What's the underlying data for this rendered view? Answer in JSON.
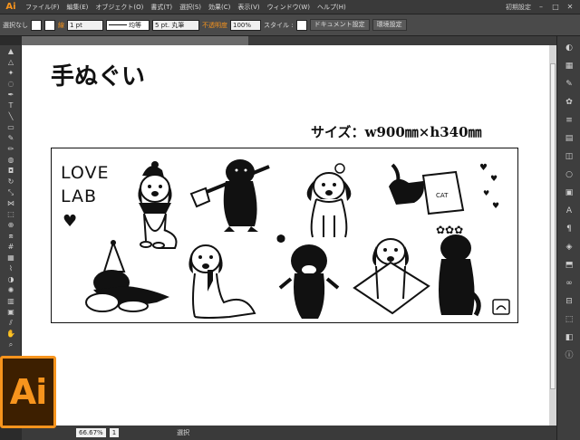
{
  "app": {
    "logo": "Ai",
    "menu": [
      "ファイル(F)",
      "編集(E)",
      "オブジェクト(O)",
      "書式(T)",
      "選択(S)",
      "効果(C)",
      "表示(V)",
      "ウィンドウ(W)",
      "ヘルプ(H)"
    ],
    "workspace": "初期設定",
    "window_controls": [
      "–",
      "□",
      "✕"
    ]
  },
  "control_bar": {
    "selection": "選択なし",
    "stroke_label": "線",
    "stroke_weight": "1 pt",
    "stroke_style": "均等",
    "brush": "5 pt. 丸筆",
    "opacity_label": "不透明度",
    "opacity_value": "100%",
    "style_label": "スタイル :",
    "doc_settings_button": "ドキュメント設定",
    "prefs_button": "環境設定"
  },
  "document": {
    "title": "手ぬぐい",
    "size_text": "サイズ：w900㎜×h340㎜",
    "love_lab_text": "LOVE\nLAB"
  },
  "statusbar": {
    "zoom": "66.67%",
    "page": "1",
    "tool": "選択"
  },
  "big_logo": "Ai",
  "colors": {
    "accent": "#f7941d",
    "canvas": "#ffffff",
    "ui_dark": "#3a3a3a"
  }
}
